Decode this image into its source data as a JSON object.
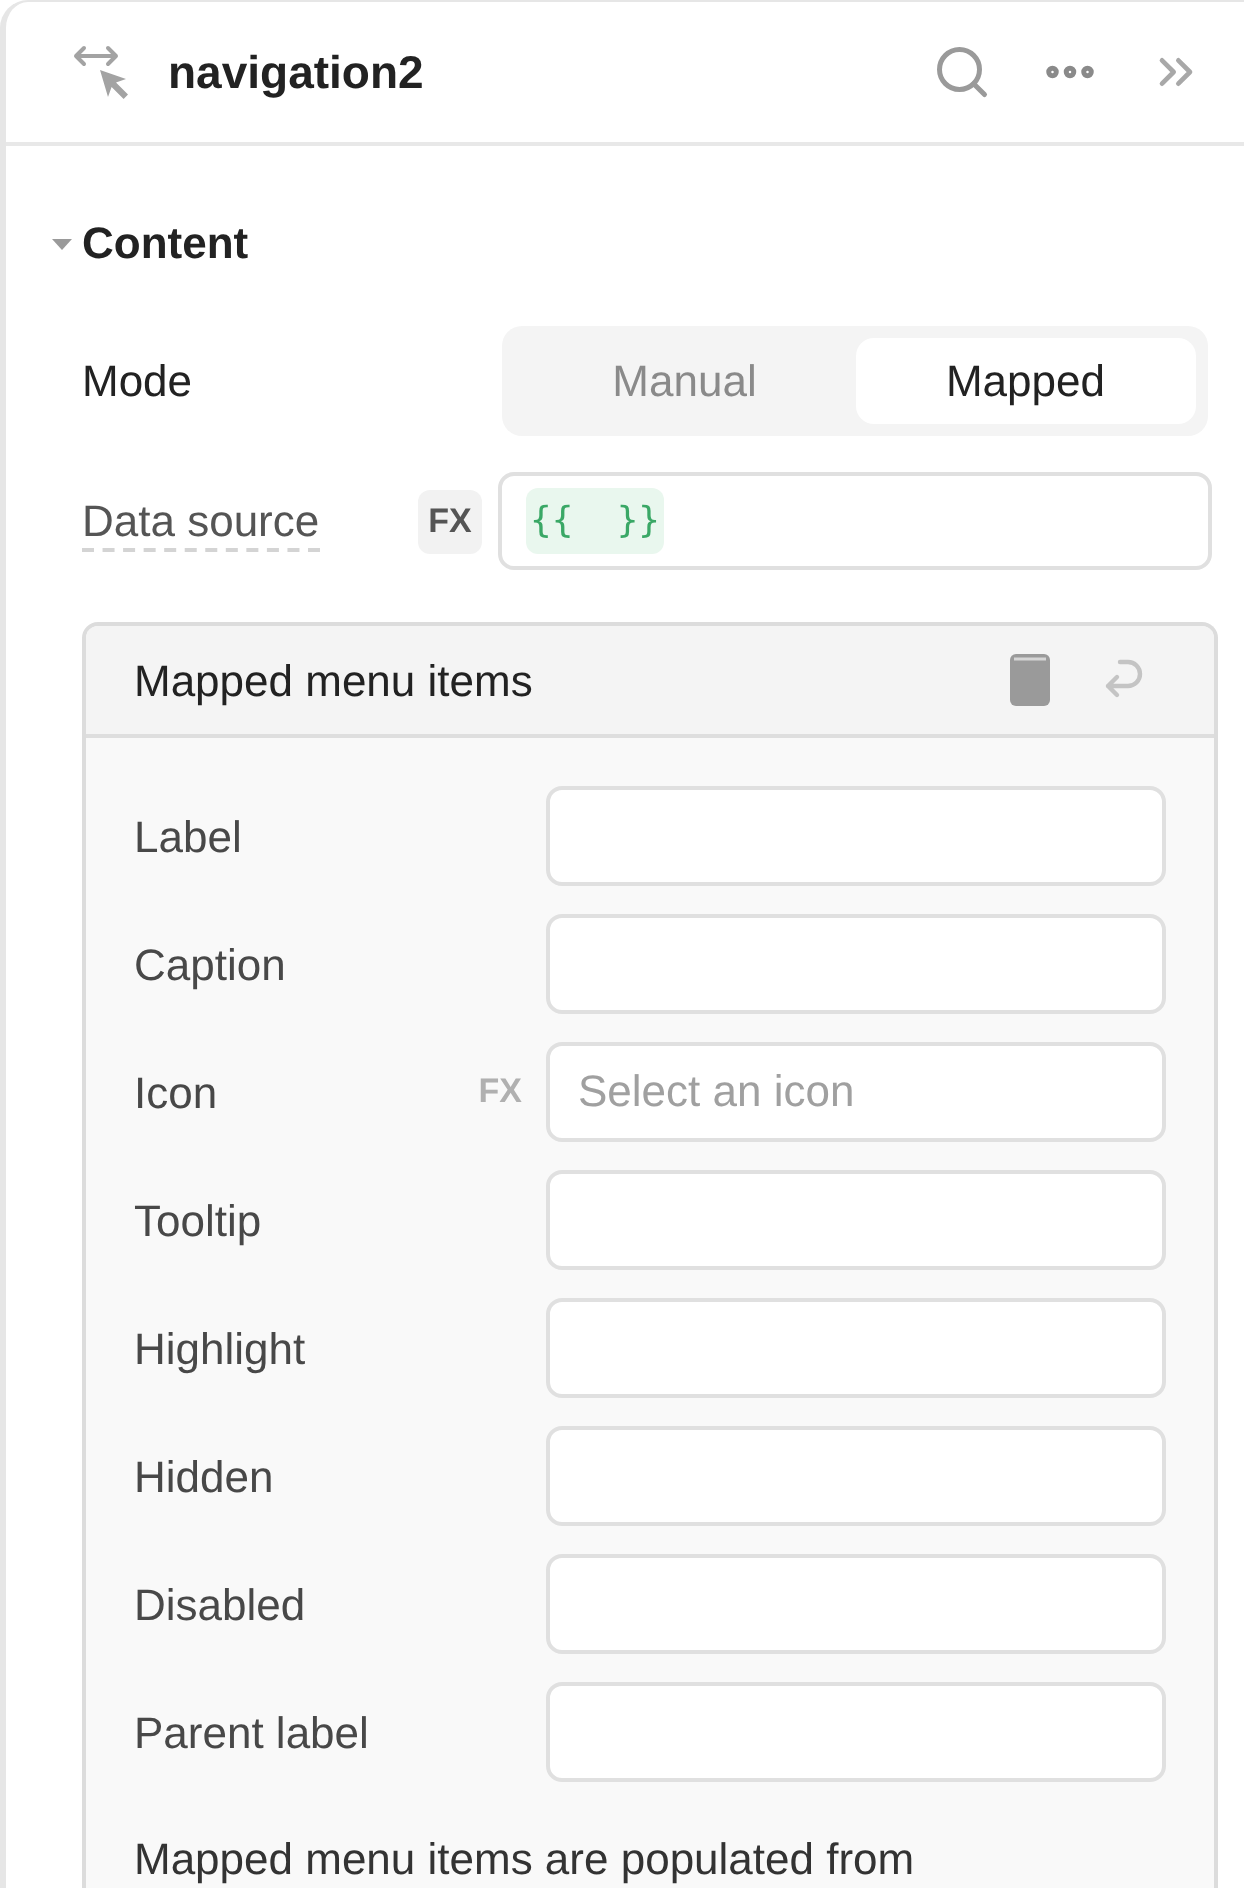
{
  "panel": {
    "title": "navigation2"
  },
  "section": {
    "title": "Content",
    "expanded": true
  },
  "mode": {
    "label": "Mode",
    "options": [
      {
        "label": "Manual",
        "selected": false
      },
      {
        "label": "Mapped",
        "selected": true
      }
    ]
  },
  "data_source": {
    "label": "Data source",
    "fx_badge": "FX",
    "value": "{{  }}"
  },
  "mapped_items": {
    "title": "Mapped menu items",
    "fields": [
      {
        "label": "Label"
      },
      {
        "label": "Caption"
      },
      {
        "label": "Icon",
        "fx_badge": "FX",
        "placeholder": "Select an icon"
      },
      {
        "label": "Tooltip"
      },
      {
        "label": "Highlight"
      },
      {
        "label": "Hidden"
      },
      {
        "label": "Disabled"
      },
      {
        "label": "Parent label"
      }
    ],
    "note": "Mapped menu items are populated from"
  }
}
